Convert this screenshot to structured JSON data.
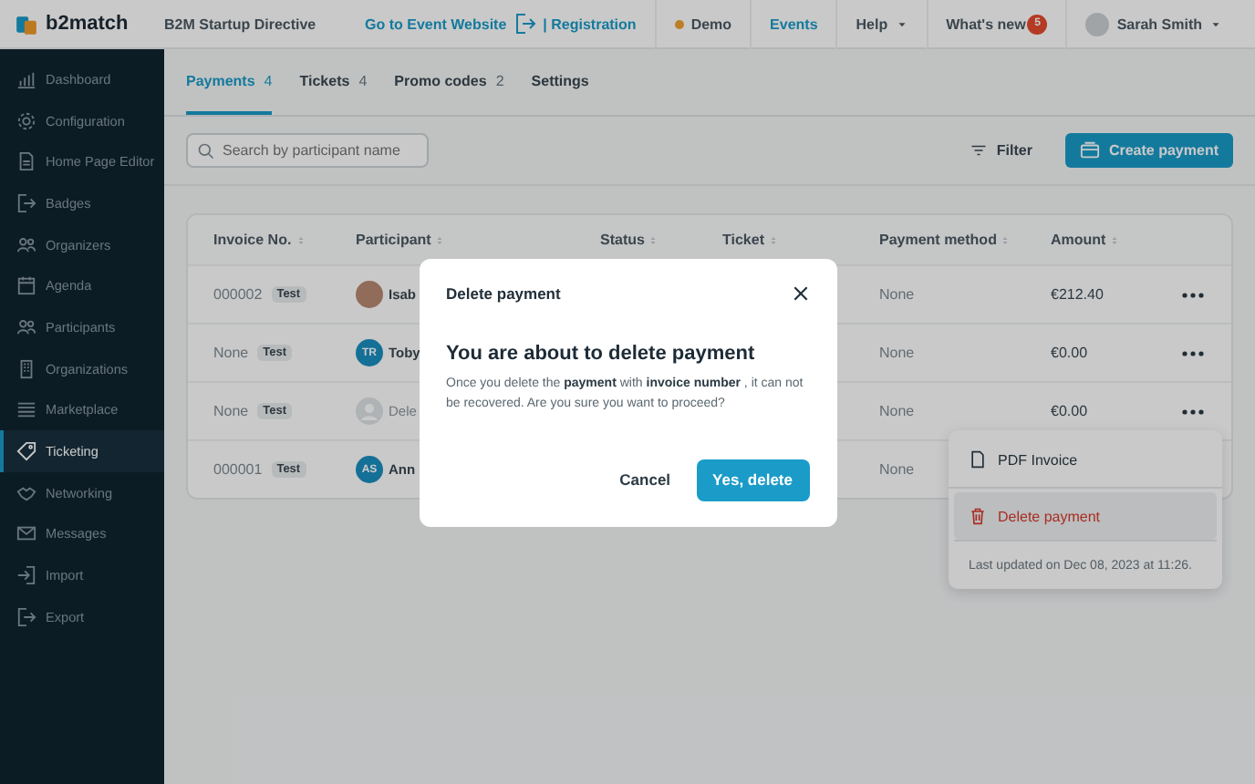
{
  "topbar": {
    "logo_text": "b2match",
    "event_name": "B2M Startup Directive",
    "website_link": "Go to Event Website",
    "registration_link": "| Registration",
    "demo": "Demo",
    "events": "Events",
    "help": "Help",
    "whats_new": "What's new",
    "notification_count": "5",
    "user_name": "Sarah Smith"
  },
  "sidebar": {
    "items": [
      {
        "label": "Dashboard",
        "selected": false
      },
      {
        "label": "Configuration",
        "selected": false
      },
      {
        "label": "Home Page Editor",
        "selected": false
      },
      {
        "label": "Badges",
        "selected": false
      },
      {
        "label": "Organizers",
        "selected": false
      },
      {
        "label": "Agenda",
        "selected": false
      },
      {
        "label": "Participants",
        "selected": false
      },
      {
        "label": "Organizations",
        "selected": false
      },
      {
        "label": "Marketplace",
        "selected": false
      },
      {
        "label": "Ticketing",
        "selected": true
      },
      {
        "label": "Networking",
        "selected": false
      },
      {
        "label": "Messages",
        "selected": false
      },
      {
        "label": "Import",
        "selected": false
      },
      {
        "label": "Export",
        "selected": false
      }
    ]
  },
  "tabs": [
    {
      "label": "Payments",
      "count": "4",
      "selected": true
    },
    {
      "label": "Tickets",
      "count": "4",
      "selected": false
    },
    {
      "label": "Promo codes",
      "count": "2",
      "selected": false
    },
    {
      "label": "Settings",
      "selected": false
    }
  ],
  "search": {
    "placeholder": "Search by participant name"
  },
  "filter_button": "Filter",
  "create_button": "Create payment",
  "table": {
    "columns": [
      "Invoice No.",
      "Participant",
      "Status",
      "Ticket",
      "Payment method",
      "Amount"
    ],
    "rows": [
      {
        "invoice": "000002",
        "tag": "Test",
        "participant": {
          "kind": "photo",
          "name": "Isab"
        },
        "payment_method": "None",
        "amount": "€212.40"
      },
      {
        "invoice": "None",
        "tag": "Test",
        "participant": {
          "kind": "initials",
          "initials": "TR",
          "name": "Toby"
        },
        "payment_method": "None",
        "amount": "€0.00"
      },
      {
        "invoice": "None",
        "tag": "Test",
        "participant": {
          "kind": "deleted",
          "name": "Dele"
        },
        "payment_method": "None",
        "amount": "€0.00"
      },
      {
        "invoice": "000001",
        "tag": "Test",
        "participant": {
          "kind": "initials",
          "initials": "AS",
          "name": "Ann"
        },
        "payment_method": "None"
      }
    ]
  },
  "row_menu": {
    "items": [
      {
        "label": "PDF Invoice",
        "kind": "file",
        "selected": false
      },
      {
        "label": "Delete payment",
        "kind": "delete",
        "selected": true
      }
    ],
    "footer": "Last updated on Dec 08, 2023 at 11:26."
  },
  "modal": {
    "title": "Delete payment",
    "heading": "You are about to delete payment",
    "body": "Once you delete the **payment** with **invoice number** , it can not be recovered. Are you sure you want to proceed?",
    "cancel_button": "Cancel",
    "confirm_button": "Yes, delete"
  }
}
